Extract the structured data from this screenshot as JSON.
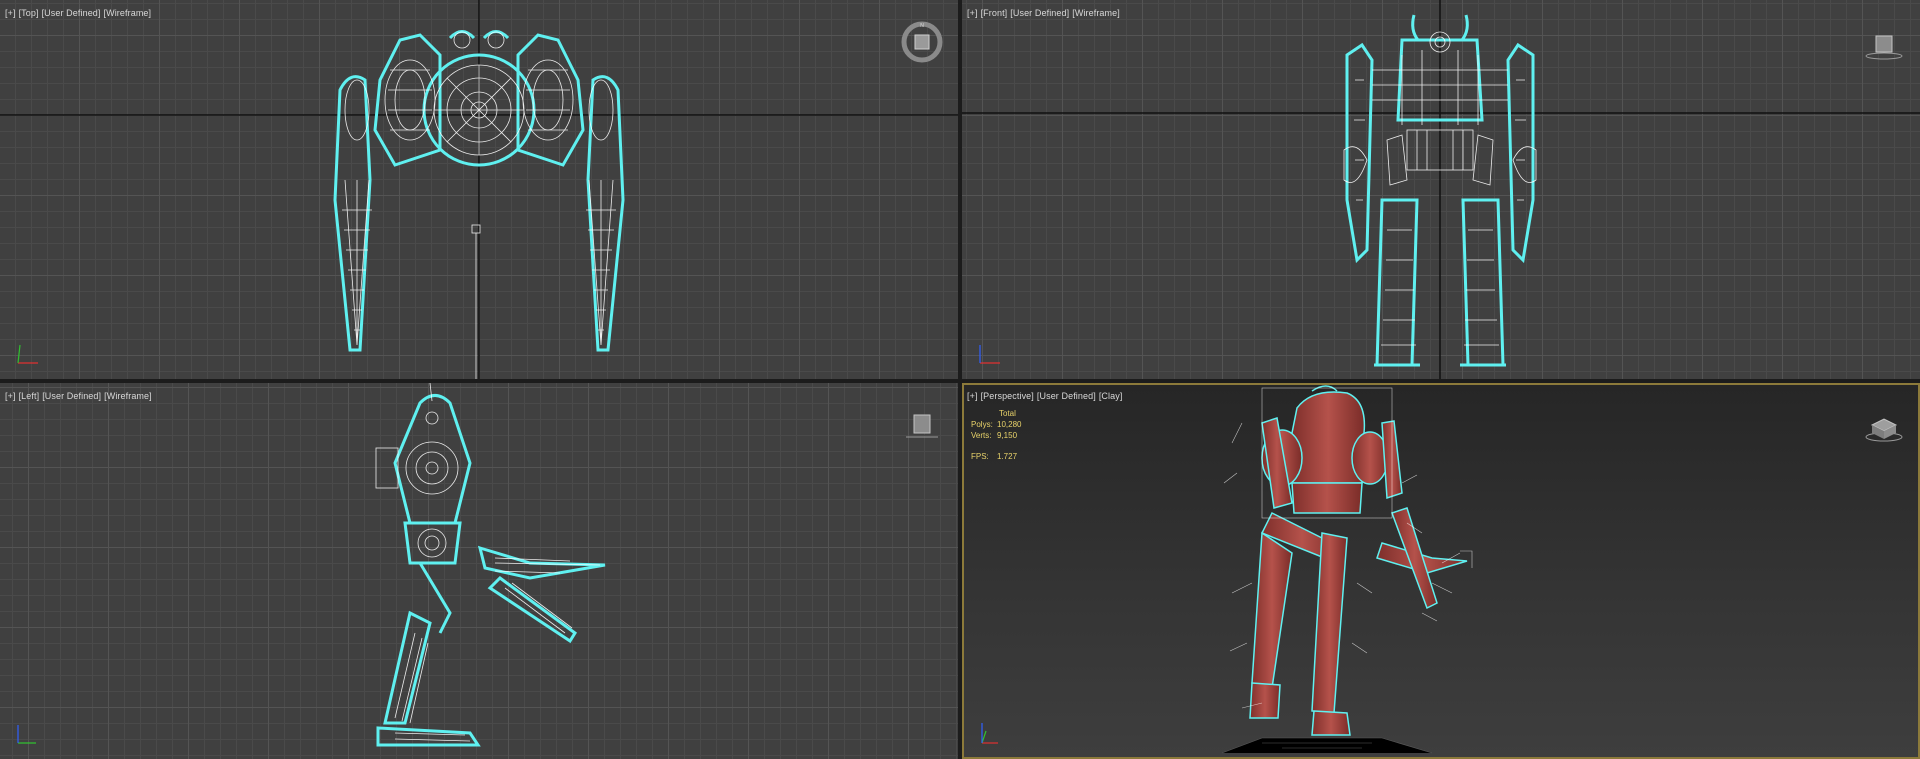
{
  "viewports": {
    "top": {
      "labels": [
        "[+]",
        "[Top]",
        "[User Defined]",
        "[Wireframe]"
      ]
    },
    "front": {
      "labels": [
        "[+]",
        "[Front]",
        "[User Defined]",
        "[Wireframe]"
      ]
    },
    "left": {
      "labels": [
        "[+]",
        "[Left]",
        "[User Defined]",
        "[Wireframe]"
      ]
    },
    "perspective": {
      "labels": [
        "[+]",
        "[Perspective]",
        "[User Defined]",
        "[Clay]"
      ],
      "stats": {
        "title": "Total",
        "polys_label": "Polys:",
        "polys_value": "10,280",
        "verts_label": "Verts:",
        "verts_value": "9,150",
        "fps_label": "FPS:",
        "fps_value": "1.727"
      }
    }
  },
  "colors": {
    "wire": "#ffffff",
    "selection": "#5ff0f0",
    "clay": "#b04a44",
    "active_border": "#8c7a3a"
  },
  "icons": {
    "viewcube": "viewcube-icon",
    "axis_tripod": "axis-tripod-icon",
    "compass": "compass-icon"
  }
}
